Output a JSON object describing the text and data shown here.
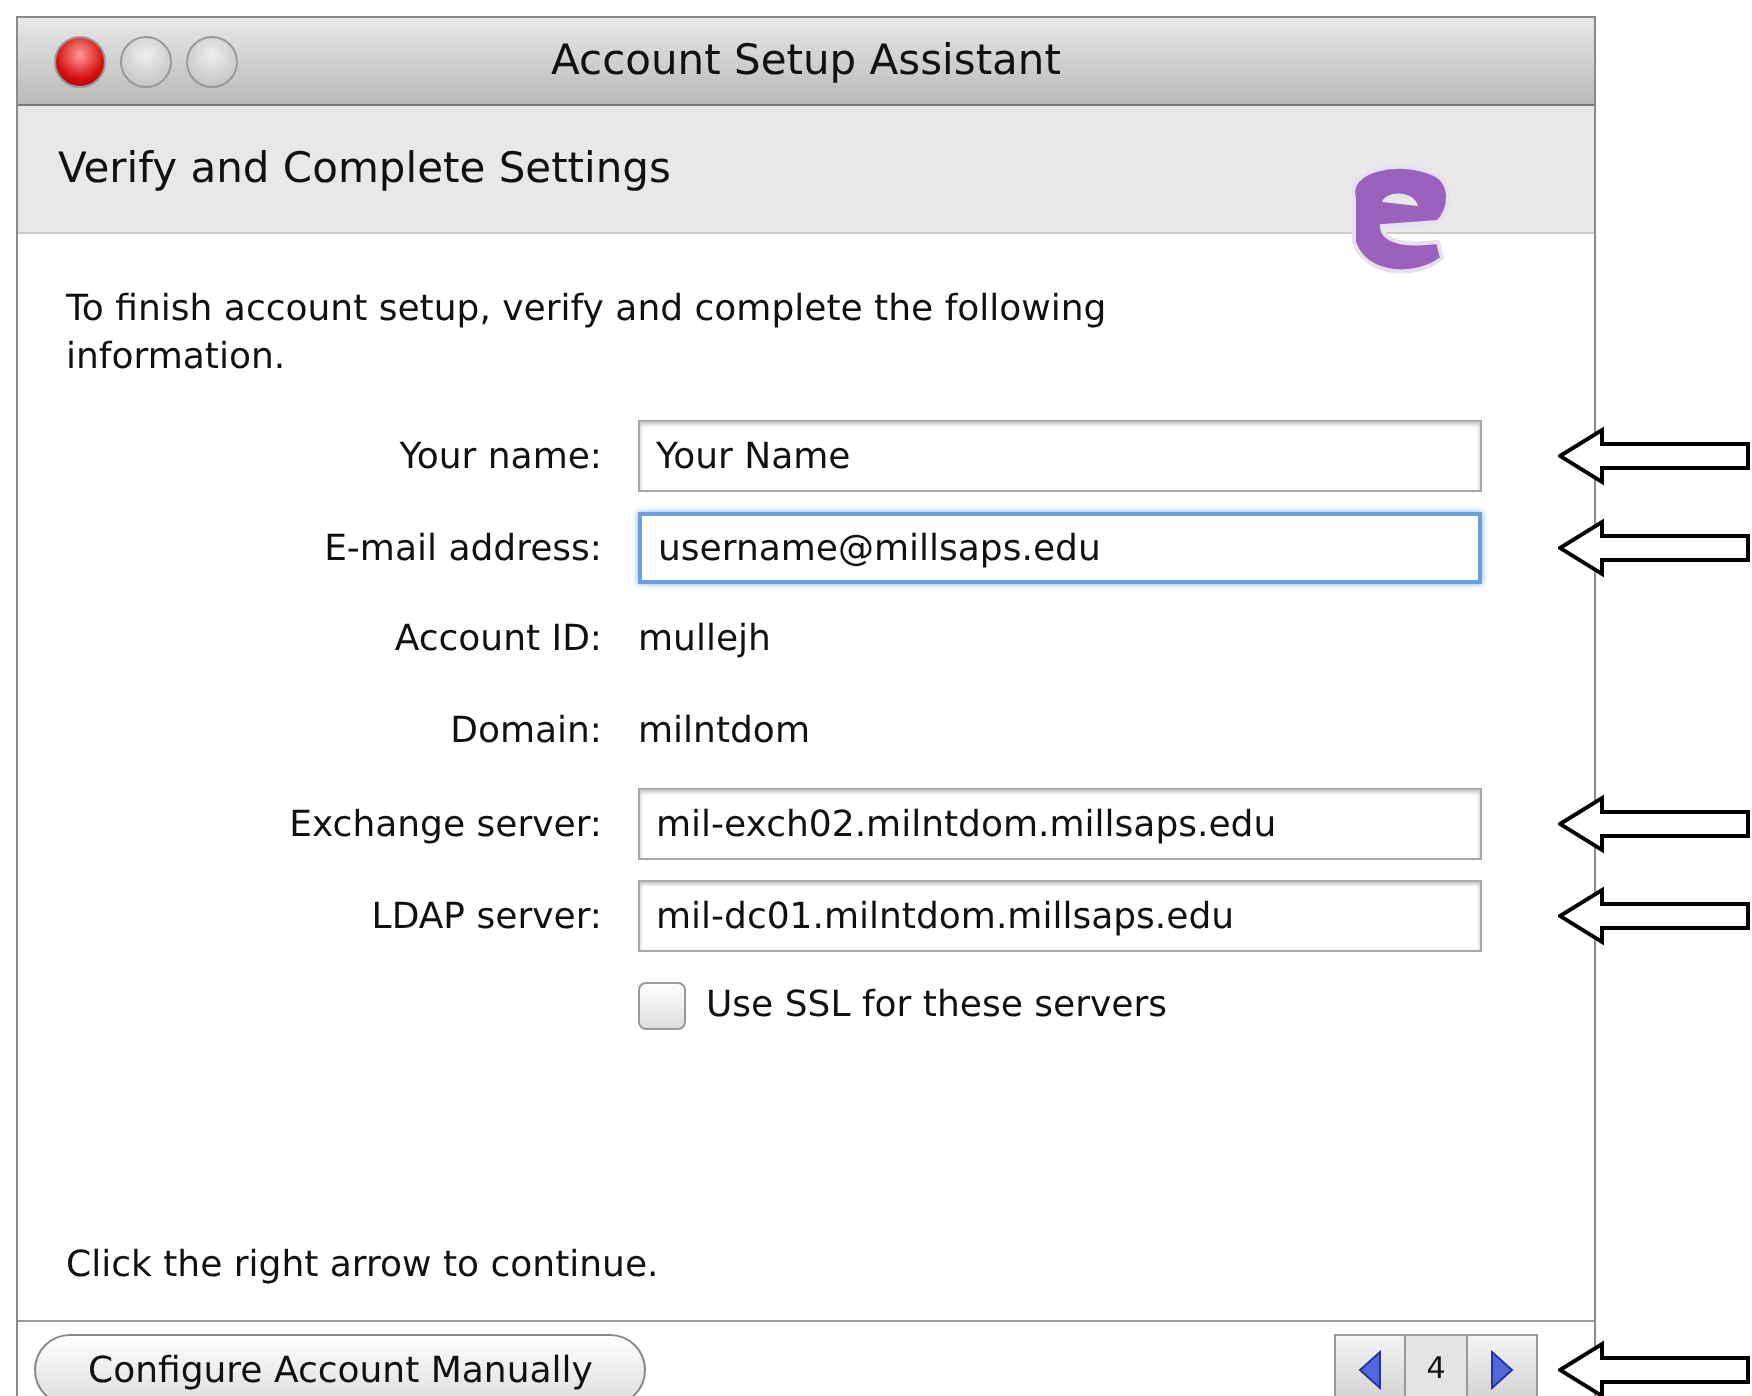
{
  "window": {
    "title": "Account Setup Assistant",
    "buttons": [
      {
        "kind": "close"
      },
      {
        "kind": "minimize"
      },
      {
        "kind": "zoom"
      }
    ]
  },
  "header": {
    "title": "Verify and Complete Settings"
  },
  "intro": "To finish account setup, verify and complete the following information.",
  "fields": [
    {
      "kind": "input",
      "label": "Your name:",
      "value": "Your Name",
      "focused": false,
      "annotated": true
    },
    {
      "kind": "input",
      "label": "E-mail address:",
      "value": "username@millsaps.edu",
      "focused": true,
      "annotated": true
    },
    {
      "kind": "text",
      "label": "Account ID:",
      "value": "mullejh",
      "annotated": false
    },
    {
      "kind": "text",
      "label": "Domain:",
      "value": "milntdom",
      "annotated": false
    },
    {
      "kind": "input",
      "label": "Exchange server:",
      "value": "mil-exch02.milntdom.millsaps.edu",
      "focused": false,
      "annotated": true
    },
    {
      "kind": "input",
      "label": "LDAP server:",
      "value": "mil-dc01.milntdom.millsaps.edu",
      "focused": false,
      "annotated": true
    }
  ],
  "ssl": {
    "label": "Use SSL for these servers",
    "checked": false
  },
  "note": "Click the right arrow to continue.",
  "footer": {
    "button": "Configure Account Manually",
    "page": "4",
    "annotated": true
  }
}
